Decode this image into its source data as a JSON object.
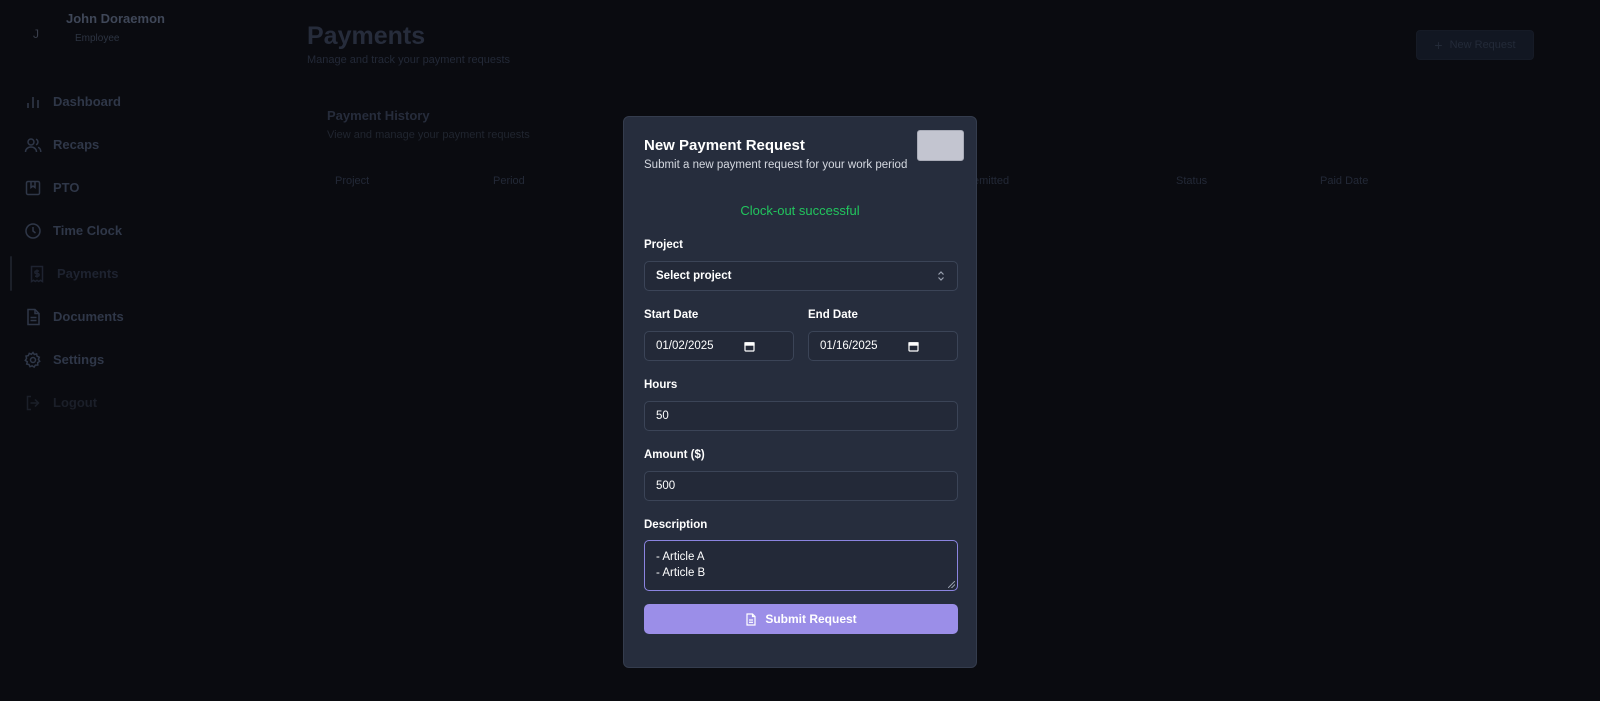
{
  "user": {
    "initial": "J",
    "name": "John Doraemon",
    "role": "Employee"
  },
  "nav": [
    {
      "label": "Dashboard",
      "icon": "bar-chart-icon"
    },
    {
      "label": "Recaps",
      "icon": "users-icon"
    },
    {
      "label": "PTO",
      "icon": "bookmark-icon"
    },
    {
      "label": "Time Clock",
      "icon": "clock-icon"
    },
    {
      "label": "Payments",
      "icon": "dollar-receipt-icon"
    },
    {
      "label": "Documents",
      "icon": "document-icon"
    },
    {
      "label": "Settings",
      "icon": "gear-icon"
    },
    {
      "label": "Logout",
      "icon": "logout-icon"
    }
  ],
  "page": {
    "title": "Payments",
    "subtitle": "Manage and track your payment requests",
    "new_request_label": "New Request"
  },
  "history": {
    "title": "Payment History",
    "subtitle": "View and manage your payment requests",
    "columns": [
      "Project",
      "Period",
      "emitted",
      "Status",
      "Paid Date"
    ]
  },
  "modal": {
    "title": "New Payment Request",
    "subtitle": "Submit a new payment request for your work period",
    "success_message": "Clock-out successful",
    "project": {
      "label": "Project",
      "value": "Select project"
    },
    "start_date": {
      "label": "Start Date",
      "value": "01/02/2025"
    },
    "end_date": {
      "label": "End Date",
      "value": "01/16/2025"
    },
    "hours": {
      "label": "Hours",
      "value": "50"
    },
    "amount": {
      "label": "Amount ($)",
      "value": "500"
    },
    "description": {
      "label": "Description",
      "lines": [
        "- Article A",
        "- Article B"
      ]
    },
    "submit_label": "Submit Request"
  },
  "colors": {
    "background": "#0a0b10",
    "modal_bg": "#262d3d",
    "success": "#22c55e",
    "accent": "#9b8ee8"
  }
}
